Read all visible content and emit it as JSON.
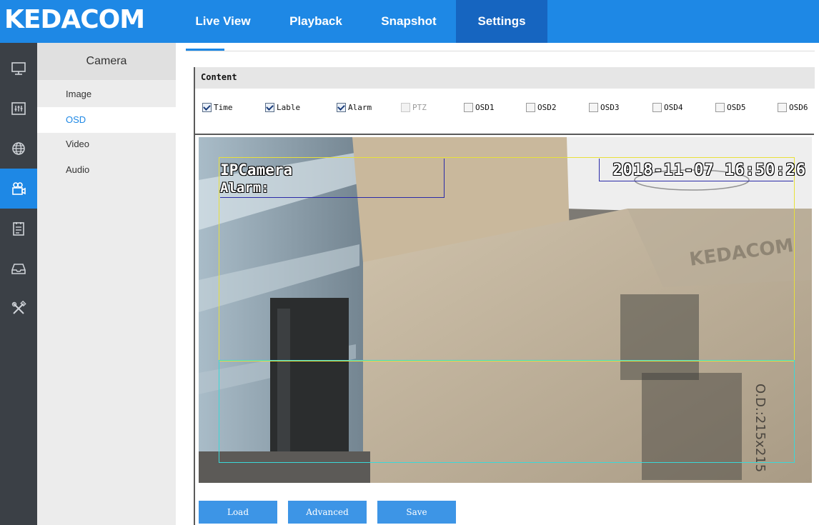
{
  "brand": {
    "logo_text": "KEDACOM",
    "accent": "#1e88e5",
    "accent_dark": "#1665c0"
  },
  "nav": {
    "tabs": [
      {
        "label": "Live View"
      },
      {
        "label": "Playback"
      },
      {
        "label": "Snapshot"
      },
      {
        "label": "Settings",
        "active": true
      }
    ]
  },
  "rail": {
    "items": [
      {
        "icon": "monitor-icon"
      },
      {
        "icon": "equalizer-icon"
      },
      {
        "icon": "network-globe-icon"
      },
      {
        "icon": "camera-icon",
        "active": true
      },
      {
        "icon": "event-clipboard-icon"
      },
      {
        "icon": "storage-tray-icon"
      },
      {
        "icon": "tools-icon"
      }
    ]
  },
  "submenu": {
    "title": "Camera",
    "items": [
      {
        "label": "Image"
      },
      {
        "label": "OSD",
        "active": true
      },
      {
        "label": "Video"
      },
      {
        "label": "Audio"
      }
    ]
  },
  "content": {
    "title": "Content",
    "checkboxes": [
      {
        "label": "Time",
        "checked": true,
        "disabled": false
      },
      {
        "label": "Lable",
        "checked": true,
        "disabled": false
      },
      {
        "label": "Alarm",
        "checked": true,
        "disabled": false
      },
      {
        "label": "PTZ",
        "checked": false,
        "disabled": true
      },
      {
        "label": "OSD1",
        "checked": false,
        "disabled": false
      },
      {
        "label": "OSD2",
        "checked": false,
        "disabled": false
      },
      {
        "label": "OSD3",
        "checked": false,
        "disabled": false
      },
      {
        "label": "OSD4",
        "checked": false,
        "disabled": false
      },
      {
        "label": "OSD5",
        "checked": false,
        "disabled": false
      },
      {
        "label": "OSD6",
        "checked": false,
        "disabled": false
      }
    ]
  },
  "preview": {
    "osd_time": "2018-11-07 16:50:26",
    "osd_label": "IPCamera",
    "osd_alarm": "Alarm:",
    "scene_text_box": "KEDACOM",
    "scene_text_box_side": "O.D.:215x215",
    "frame_colors": {
      "yellow": "#e8e03a",
      "cyan": "#3ad8d8",
      "blue": "#2a2aa8"
    }
  },
  "buttons": {
    "load": "Load",
    "advanced": "Advanced",
    "save": "Save"
  }
}
